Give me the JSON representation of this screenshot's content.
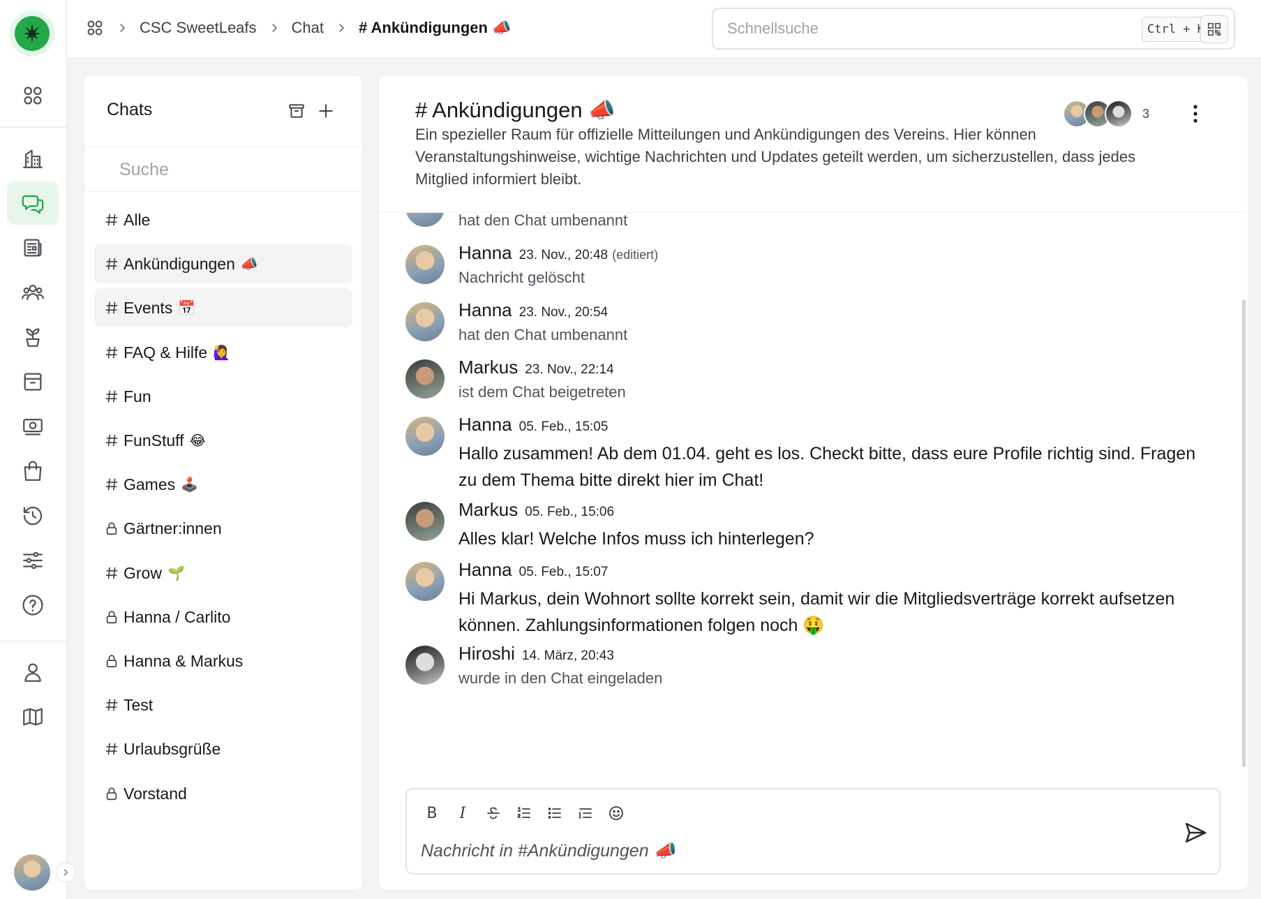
{
  "breadcrumb": {
    "org": "CSC SweetLeafs",
    "section": "Chat",
    "current": "# Ankündigungen 📣"
  },
  "search": {
    "placeholder": "Schnellsuche",
    "shortcut": "Ctrl + K"
  },
  "chatlist": {
    "title": "Chats",
    "search_placeholder": "Suche",
    "items": [
      {
        "type": "channel",
        "label": "Alle",
        "emoji": ""
      },
      {
        "type": "channel",
        "label": "Ankündigungen",
        "emoji": "📣"
      },
      {
        "type": "channel",
        "label": "Events",
        "emoji": "📅"
      },
      {
        "type": "channel",
        "label": "FAQ & Hilfe",
        "emoji": "🙋‍♀️"
      },
      {
        "type": "channel",
        "label": "Fun",
        "emoji": ""
      },
      {
        "type": "channel",
        "label": "FunStuff",
        "emoji": "😂"
      },
      {
        "type": "channel",
        "label": "Games",
        "emoji": "🕹️"
      },
      {
        "type": "private",
        "label": "Gärtner:innen",
        "emoji": ""
      },
      {
        "type": "channel",
        "label": "Grow",
        "emoji": "🌱"
      },
      {
        "type": "private",
        "label": "Hanna / Carlito",
        "emoji": ""
      },
      {
        "type": "private",
        "label": "Hanna & Markus",
        "emoji": ""
      },
      {
        "type": "channel",
        "label": "Test",
        "emoji": ""
      },
      {
        "type": "channel",
        "label": "Urlaubsgrüße",
        "emoji": ""
      },
      {
        "type": "private",
        "label": "Vorstand",
        "emoji": ""
      }
    ]
  },
  "channel": {
    "title": "# Ankündigungen 📣",
    "description": "Ein spezieller Raum für offizielle Mitteilungen und Ankündigungen des Vereins. Hier können Veranstaltungshinweise, wichtige Nachrichten und Updates geteilt werden, um sicherzustellen, dass jedes Mitglied informiert bleibt.",
    "member_count": "3"
  },
  "messages": [
    {
      "author": "",
      "time": "",
      "edited": "",
      "text": "hat den Chat umbenannt",
      "system": true
    },
    {
      "author": "Hanna",
      "time": "23. Nov., 20:48",
      "edited": "(editiert)",
      "text": "Nachricht gelöscht",
      "system": true
    },
    {
      "author": "Hanna",
      "time": "23. Nov., 20:54",
      "edited": "",
      "text": "hat den Chat umbenannt",
      "system": true
    },
    {
      "author": "Markus",
      "time": "23. Nov., 22:14",
      "edited": "",
      "text": "ist dem Chat beigetreten",
      "system": true
    },
    {
      "author": "Hanna",
      "time": "05. Feb., 15:05",
      "edited": "",
      "text": "Hallo zusammen! Ab dem 01.04. geht es los. Checkt bitte, dass eure Profile richtig sind. Fragen zu dem Thema bitte direkt hier im Chat!",
      "system": false
    },
    {
      "author": "Markus",
      "time": "05. Feb., 15:06",
      "edited": "",
      "text": "Alles klar! Welche Infos muss ich hinterlegen?",
      "system": false
    },
    {
      "author": "Hanna",
      "time": "05. Feb., 15:07",
      "edited": "",
      "text": "Hi Markus, dein Wohnort sollte korrekt sein, damit wir die Mitgliedsverträge korrekt aufsetzen können. Zahlungsinformationen folgen noch 🤑",
      "system": false
    },
    {
      "author": "Hiroshi",
      "time": "14. März, 20:43",
      "edited": "",
      "text": "wurde in den Chat eingeladen",
      "system": true
    }
  ],
  "composer": {
    "placeholder": "Nachricht in #Ankündigungen 📣",
    "bold": "B",
    "italic": "I"
  },
  "colors": {
    "accent": "#22a84a",
    "accent_bg": "#e7f6ea"
  }
}
